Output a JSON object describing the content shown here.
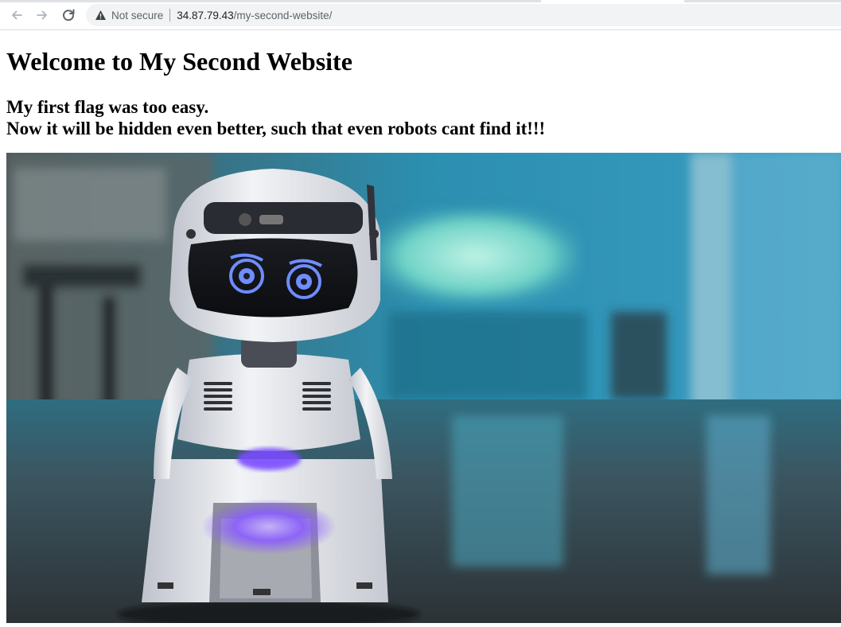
{
  "browser": {
    "security_label": "Not secure",
    "url_host": "34.87.79.43",
    "url_path": "/my-second-website/"
  },
  "page": {
    "title": "Welcome to My Second Website",
    "subtitle_line1": "My first flag was too easy.",
    "subtitle_line2": "Now it will be hidden even better, such that even robots cant find it!!!"
  },
  "colors": {
    "room_background": "#2f8fb0",
    "robot_body": "#e8e9ee",
    "robot_eyes": "#6f8dff",
    "robot_glow": "#8a5cff",
    "floor": "#3a4247"
  },
  "icons": {
    "back": "arrow-left-icon",
    "forward": "arrow-right-icon",
    "reload": "reload-icon",
    "warning": "warning-triangle-icon"
  }
}
